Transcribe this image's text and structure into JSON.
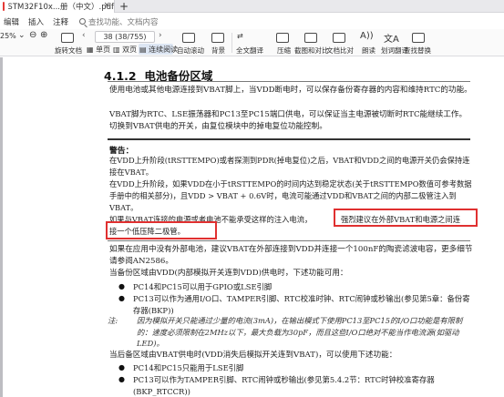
{
  "tab": {
    "title": "STM32F10x...册（中文）.pdf",
    "close": "×",
    "add": "+"
  },
  "menu": {
    "items": [
      "编辑",
      "插入",
      "注释"
    ],
    "search_placeholder": "查找功能、文档内容"
  },
  "toolbar": {
    "zoom": "25%",
    "zoom_out": "⊖",
    "zoom_in": "⊕",
    "rotate": "旋转文档",
    "page_current": "38",
    "page_display": "38 (38/755)",
    "single_page": "单页",
    "double_page": "双页",
    "continuous": "连续阅读",
    "auto_scroll": "自动滚动",
    "background": "背景",
    "full_translate": "全文翻译",
    "compress": "压缩",
    "screenshot_compare": "截图和对比",
    "read_aloud": "朗读",
    "translate": "划词翻译",
    "find_replace": "查找替换",
    "text_compare": "文档比对"
  },
  "doc": {
    "section_number": "4.1.2",
    "section_title": "电池备份区域",
    "para1": "使用电池或其他电源连接到VBAT脚上，当VDD断电时，可以保存备份寄存器的内容和维持RTC的功能。",
    "para2": "VBAT脚为RTC、LSE振荡器和PC13至PC15端口供电，可以保证当主电源被切断时RTC能继续工作。切换到VBAT供电的开关，由复位模块中的掉电复位功能控制。",
    "warning_title": "警告：",
    "warn1": "在VDD上升阶段(tRSTTEMPO)或者探测到PDR(掉电复位)之后，VBAT和VDD之间的电源开关仍会保持连接在VBAT。",
    "warn2": "在VDD上升阶段，如果VDD在小于tRSTTEMPO的时间内达到稳定状态(关于tRSTTEMPO数值可参考数据手册中的相关部分)，且VDD > VBAT + 0.6V时，电流可能通过VDD和VBAT之间的内部二极管注入到VBAT。",
    "warn3a": "如果与VBAT连接的电源或者电池不能承受这样的注入电流，",
    "warn3b": "强烈建议在外部VBAT和电源之间连",
    "warn3c": "接一个低压降二极管。",
    "para3": "如果在应用中没有外部电池，建议VBAT在外部连接到VDD并连接一个100nF的陶瓷滤波电容，更多细节请参阅AN2586。",
    "para4": "当备份区域由VDD(内部模拟开关连到VDD)供电时，下述功能可用：",
    "bullet1": "PC14和PC15可以用于GPIO或LSE引脚",
    "bullet2": "PC13可以作为通用I/O口、TAMPER引脚、RTC校准时钟、RTC闹钟或秒输出(参见第5章：备份寄存器(BKP))",
    "note_label": "注:",
    "note_text": "因为模拟开关只能通过少量的电流(3mA)，在输出模式下使用PC13至PC15的I/O口功能是有限制的：速度必须限制在2MHz以下，最大负载为30pF，而且这些I/O口绝对不能当作电流源(如驱动LED)。",
    "para5": "当后备区域由VBAT供电时(VDD消失后模拟开关连到VBAT)，可以使用下述功能：",
    "bullet3": "PC14和PC15只能用于LSE引脚",
    "bullet4": "PC13可以作为TAMPER引脚、RTC闹钟或秒输出(参见第5.4.2节：RTC时钟校准寄存器(BKP_RTCCR))"
  },
  "colors": {
    "highlight_box": "#e03030",
    "toolbar_bg": "#fafafa",
    "tab_bg": "#e9e9ec"
  }
}
